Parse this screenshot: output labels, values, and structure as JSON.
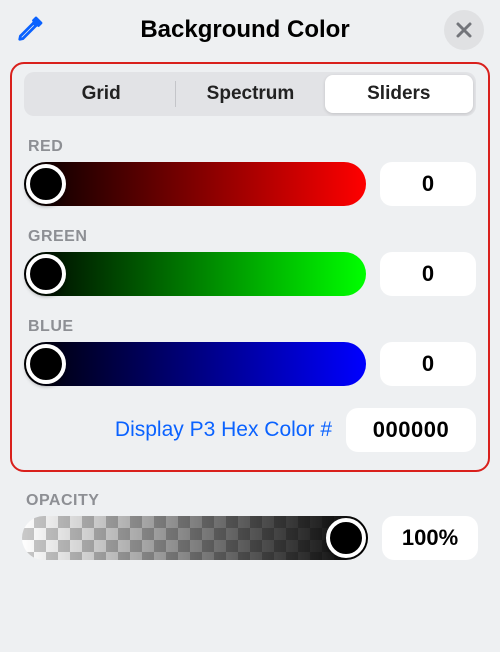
{
  "header": {
    "title": "Background Color",
    "close_icon": "×"
  },
  "tabs": {
    "items": [
      {
        "label": "Grid",
        "selected": false
      },
      {
        "label": "Spectrum",
        "selected": false
      },
      {
        "label": "Sliders",
        "selected": true
      }
    ]
  },
  "sliders": {
    "red": {
      "label": "RED",
      "value": "0"
    },
    "green": {
      "label": "GREEN",
      "value": "0"
    },
    "blue": {
      "label": "BLUE",
      "value": "0"
    }
  },
  "hex": {
    "button_label": "Display P3 Hex Color #",
    "value": "000000"
  },
  "opacity": {
    "label": "OPACITY",
    "value": "100%"
  }
}
